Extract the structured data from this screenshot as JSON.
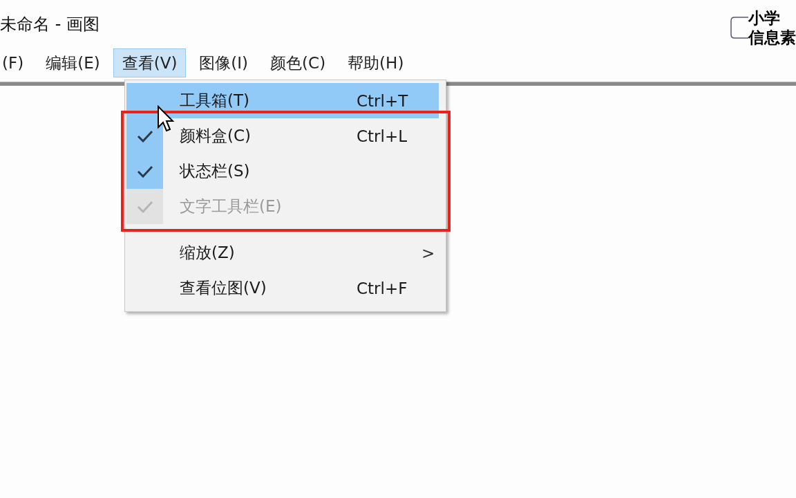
{
  "window": {
    "title": "未命名 - 画图"
  },
  "menu_bar": [
    {
      "label": "(F)",
      "selected": false
    },
    {
      "label": "编辑(E)",
      "selected": false
    },
    {
      "label": "查看(V)",
      "selected": true
    },
    {
      "label": "图像(I)",
      "selected": false
    },
    {
      "label": "颜色(C)",
      "selected": false
    },
    {
      "label": "帮助(H)",
      "selected": false
    }
  ],
  "dropdown": {
    "items": [
      {
        "kind": "item",
        "label": "工具箱(T)",
        "shortcut": "Ctrl+T",
        "checked": false,
        "disabled": false,
        "selected": true
      },
      {
        "kind": "item",
        "label": "颜料盒(C)",
        "shortcut": "Ctrl+L",
        "checked": true,
        "disabled": false,
        "selected": false
      },
      {
        "kind": "item",
        "label": "状态栏(S)",
        "checked": true,
        "disabled": false,
        "selected": false
      },
      {
        "kind": "item",
        "label": "文字工具栏(E)",
        "checked": true,
        "disabled": true,
        "selected": false
      },
      {
        "kind": "separator"
      },
      {
        "kind": "item",
        "label": "缩放(Z)",
        "submenu": ">",
        "checked": false,
        "disabled": false,
        "selected": false
      },
      {
        "kind": "item",
        "label": "查看位图(V)",
        "shortcut": "Ctrl+F",
        "checked": false,
        "disabled": false,
        "selected": false
      }
    ]
  },
  "overlay_title": [
    "小学",
    "信息素"
  ]
}
